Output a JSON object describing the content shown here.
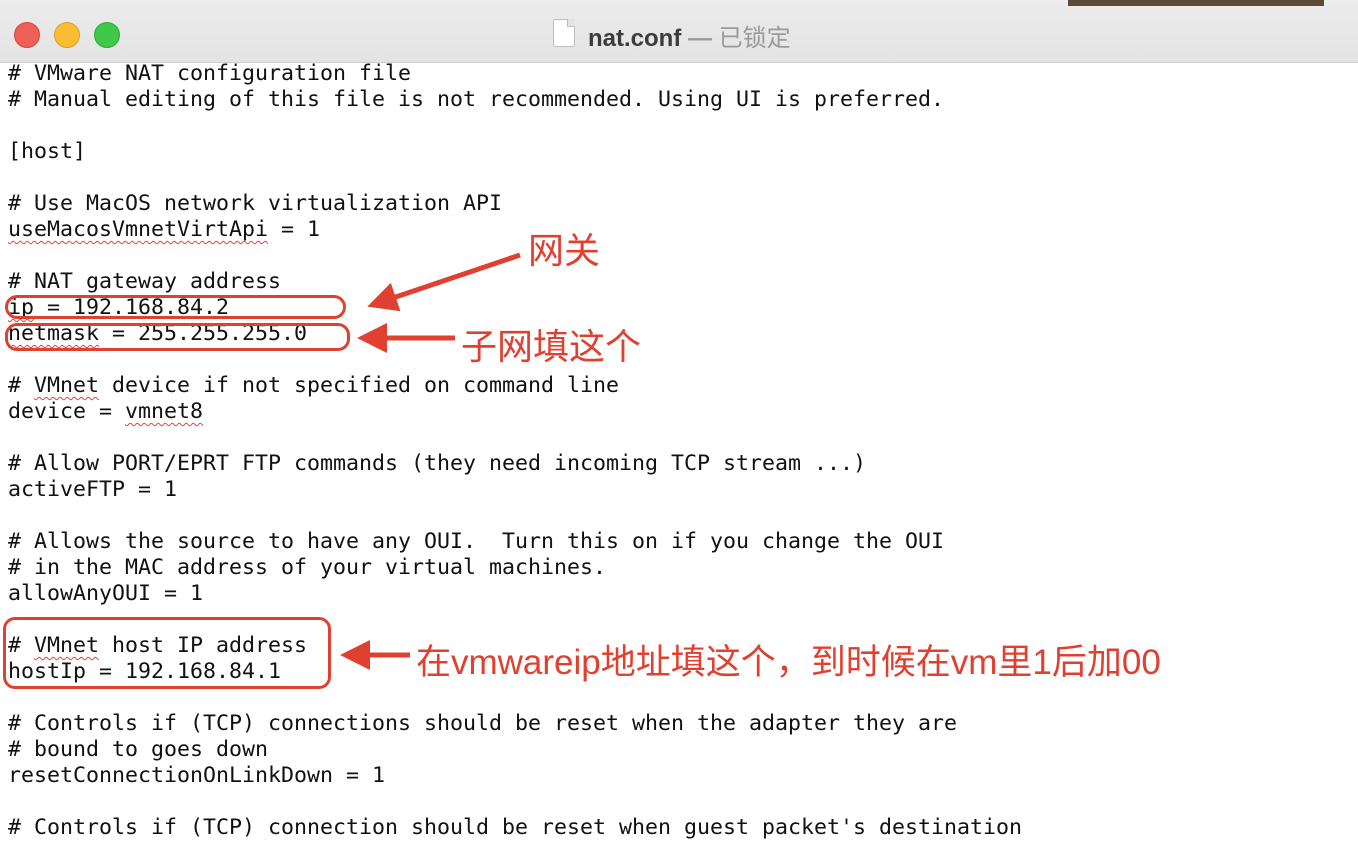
{
  "window": {
    "title": "nat.conf",
    "separator": "—",
    "status": "已锁定"
  },
  "lines": [
    "# VMware NAT configuration file",
    "# Manual editing of this file is not recommended. Using UI is preferred.",
    "",
    "[host]",
    "",
    "# Use MacOS network virtualization API",
    "useMacosVmnetVirtApi = 1",
    "",
    "# NAT gateway address",
    "ip = 192.168.84.2",
    "netmask = 255.255.255.0",
    "",
    "# VMnet device if not specified on command line",
    "device = vmnet8",
    "",
    "# Allow PORT/EPRT FTP commands (they need incoming TCP stream ...)",
    "activeFTP = 1",
    "",
    "# Allows the source to have any OUI.  Turn this on if you change the OUI",
    "# in the MAC address of your virtual machines.",
    "allowAnyOUI = 1",
    "",
    "# VMnet host IP address",
    "hostIp = 192.168.84.1",
    "",
    "# Controls if (TCP) connections should be reset when the adapter they are",
    "# bound to goes down",
    "resetConnectionOnLinkDown = 1",
    "",
    "# Controls if (TCP) connection should be reset when guest packet's destination"
  ],
  "annotations": {
    "gateway": "网关",
    "subnet": "子网填这个",
    "host_ip": "在vmwareip地址填这个，到时候在vm里1后加00"
  },
  "colors": {
    "annotation": "#e0402f",
    "spellcheck": "#e0463c"
  }
}
